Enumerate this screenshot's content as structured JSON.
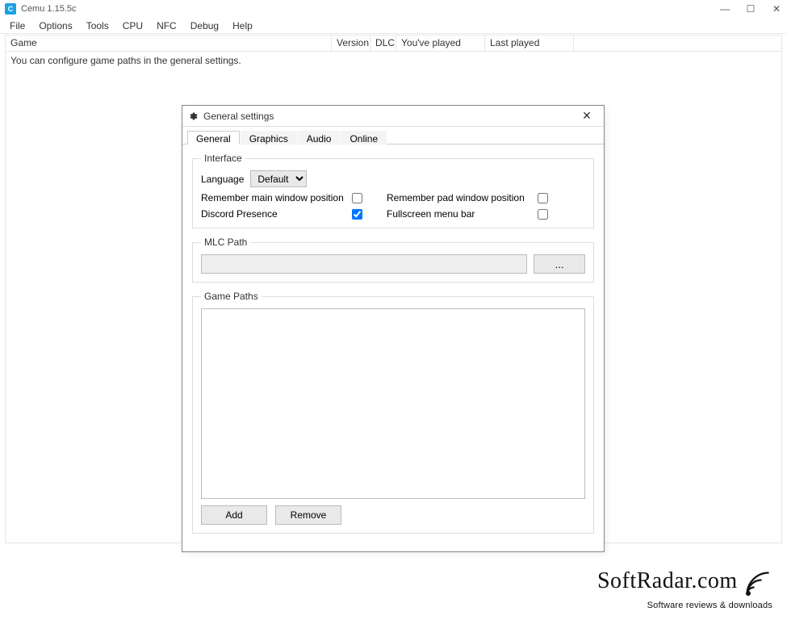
{
  "window": {
    "title": "Cemu 1.15.5c",
    "controls": {
      "min": "—",
      "max": "☐",
      "close": "✕"
    }
  },
  "menubar": [
    "File",
    "Options",
    "Tools",
    "CPU",
    "NFC",
    "Debug",
    "Help"
  ],
  "gamelist": {
    "columns": {
      "game": "Game",
      "version": "Version",
      "dlc": "DLC",
      "played": "You've played",
      "last": "Last played"
    },
    "empty_message": "You can configure game paths in the general settings."
  },
  "dialog": {
    "title": "General settings",
    "close": "✕",
    "tabs": [
      "General",
      "Graphics",
      "Audio",
      "Online"
    ],
    "active_tab": 0,
    "interface": {
      "legend": "Interface",
      "language_label": "Language",
      "language_value": "Default",
      "remember_main_label": "Remember main window position",
      "remember_main_checked": false,
      "remember_pad_label": "Remember pad window position",
      "remember_pad_checked": false,
      "discord_label": "Discord Presence",
      "discord_checked": true,
      "fullscreen_label": "Fullscreen menu bar",
      "fullscreen_checked": false
    },
    "mlc": {
      "legend": "MLC Path",
      "value": "",
      "browse_label": "..."
    },
    "gamepaths": {
      "legend": "Game Paths",
      "add_label": "Add",
      "remove_label": "Remove"
    }
  },
  "watermark": {
    "main": "SoftRadar.com",
    "sub": "Software reviews & downloads"
  }
}
